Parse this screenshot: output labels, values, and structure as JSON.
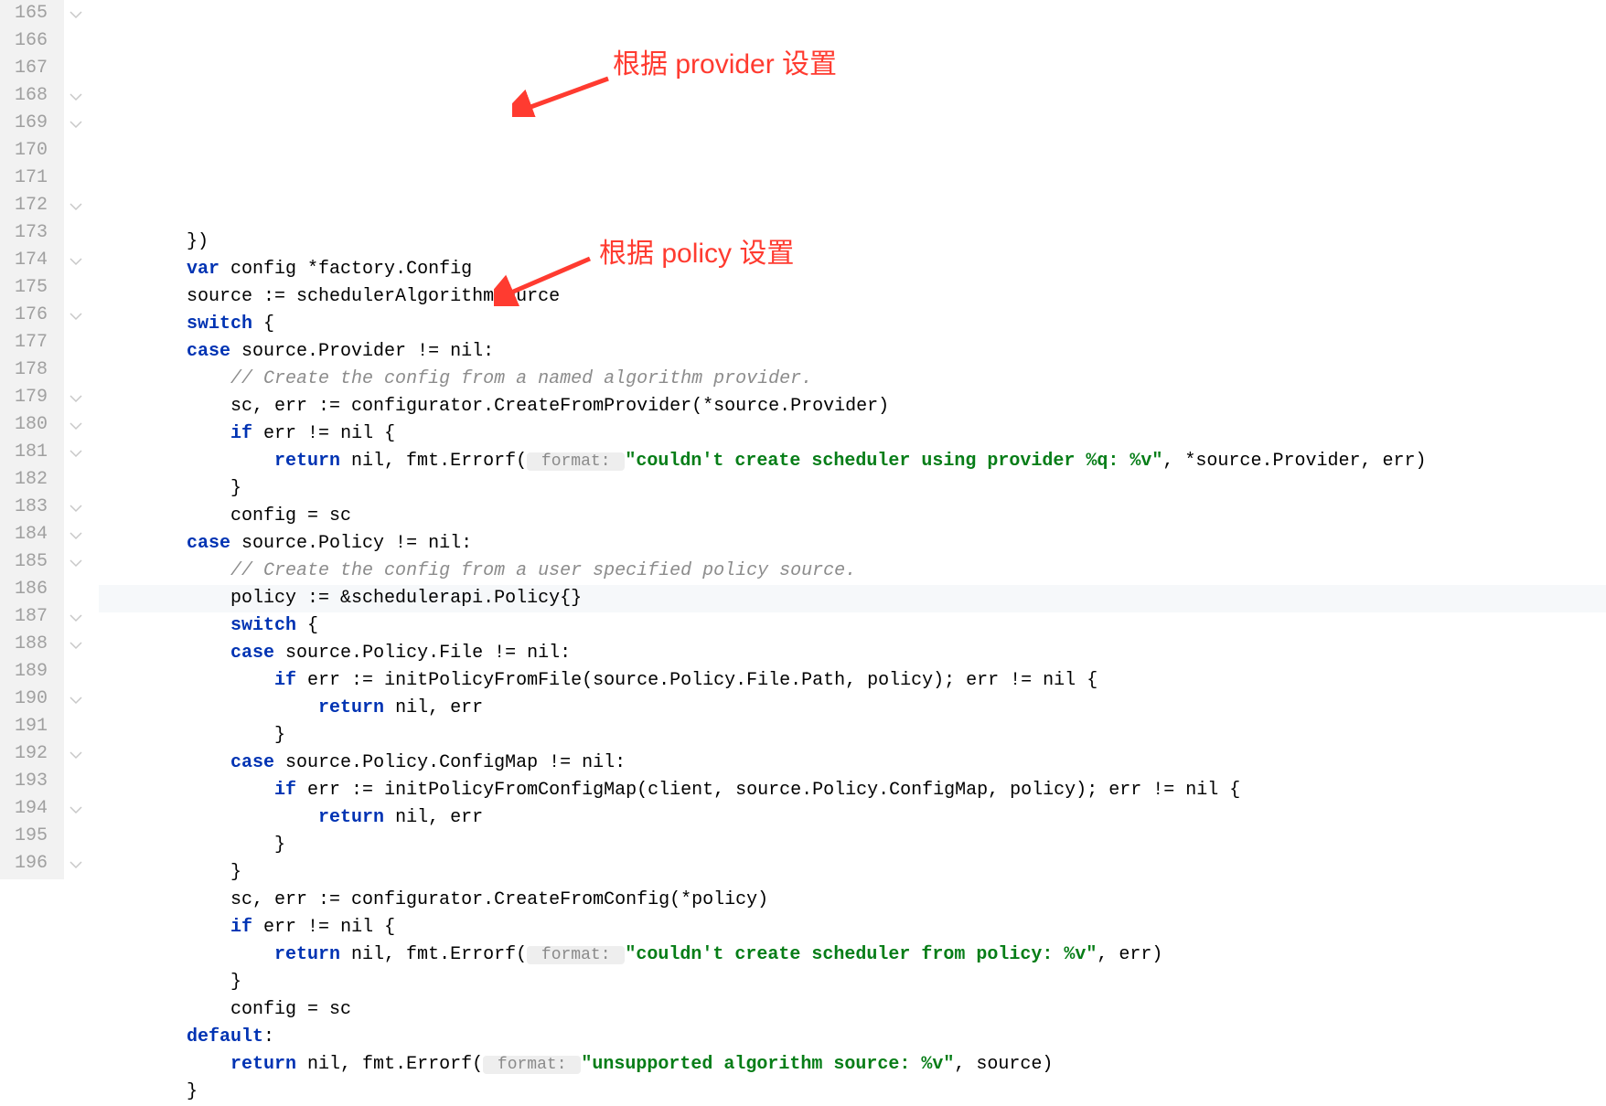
{
  "gutter": {
    "start": 165,
    "end": 196
  },
  "annotations": {
    "provider": "根据 provider 设置",
    "policy": "根据 policy 设置"
  },
  "code": {
    "l165": {
      "indent": "        ",
      "t1": "})"
    },
    "l166": {
      "indent": "        ",
      "kw": "var",
      "t1": " config *factory.Config"
    },
    "l167": {
      "indent": "        ",
      "t1": "source := schedulerAlgorithmSource"
    },
    "l168": {
      "indent": "        ",
      "kw": "switch",
      "t1": " {"
    },
    "l169": {
      "indent": "        ",
      "kw": "case",
      "t1": " source.Provider != nil:"
    },
    "l170": {
      "indent": "            ",
      "cm": "// Create the config from a named algorithm provider."
    },
    "l171": {
      "indent": "            ",
      "t1": "sc, err := configurator.CreateFromProvider(*source.Provider)"
    },
    "l172": {
      "indent": "            ",
      "kw": "if",
      "t1": " err != nil {"
    },
    "l173": {
      "indent": "                ",
      "kw": "return",
      "t1": " nil, fmt.Errorf(",
      "hint": " format: ",
      "str": "\"couldn't create scheduler using provider %q: %v\"",
      "t2": ", *source.Provider, err)"
    },
    "l174": {
      "indent": "            ",
      "t1": "}"
    },
    "l175": {
      "indent": "            ",
      "t1": "config = sc"
    },
    "l176": {
      "indent": "        ",
      "kw": "case",
      "t1": " source.Policy != nil:"
    },
    "l177": {
      "indent": "            ",
      "cm": "// Create the config from a user specified policy source."
    },
    "l178": {
      "indent": "            ",
      "t1": "policy := &schedulerapi.Policy{}"
    },
    "l179": {
      "indent": "            ",
      "kw": "switch",
      "t1": " {"
    },
    "l180": {
      "indent": "            ",
      "kw": "case",
      "t1": " source.Policy.File != nil:"
    },
    "l181": {
      "indent": "                ",
      "kw": "if",
      "t1": " err := initPolicyFromFile(source.Policy.File.Path, policy); err != nil {"
    },
    "l182": {
      "indent": "                    ",
      "kw": "return",
      "t1": " nil, err"
    },
    "l183": {
      "indent": "                ",
      "t1": "}"
    },
    "l184": {
      "indent": "            ",
      "kw": "case",
      "t1": " source.Policy.ConfigMap != nil:"
    },
    "l185": {
      "indent": "                ",
      "kw": "if",
      "t1": " err := initPolicyFromConfigMap(client, source.Policy.ConfigMap, policy); err != nil {"
    },
    "l186": {
      "indent": "                    ",
      "kw": "return",
      "t1": " nil, err"
    },
    "l187": {
      "indent": "                ",
      "t1": "}"
    },
    "l188": {
      "indent": "            ",
      "t1": "}"
    },
    "l189": {
      "indent": "            ",
      "t1": "sc, err := configurator.CreateFromConfig(*policy)"
    },
    "l190": {
      "indent": "            ",
      "kw": "if",
      "t1": " err != nil {"
    },
    "l191": {
      "indent": "                ",
      "kw": "return",
      "t1": " nil, fmt.Errorf(",
      "hint": " format: ",
      "str": "\"couldn't create scheduler from policy: %v\"",
      "t2": ", err)"
    },
    "l192": {
      "indent": "            ",
      "t1": "}"
    },
    "l193": {
      "indent": "            ",
      "t1": "config = sc"
    },
    "l194": {
      "indent": "        ",
      "kw": "default",
      "t1": ":"
    },
    "l195": {
      "indent": "            ",
      "kw": "return",
      "t1": " nil, fmt.Errorf(",
      "hint": " format: ",
      "str": "\"unsupported algorithm source: %v\"",
      "t2": ", source)"
    },
    "l196": {
      "indent": "        ",
      "t1": "}"
    }
  }
}
